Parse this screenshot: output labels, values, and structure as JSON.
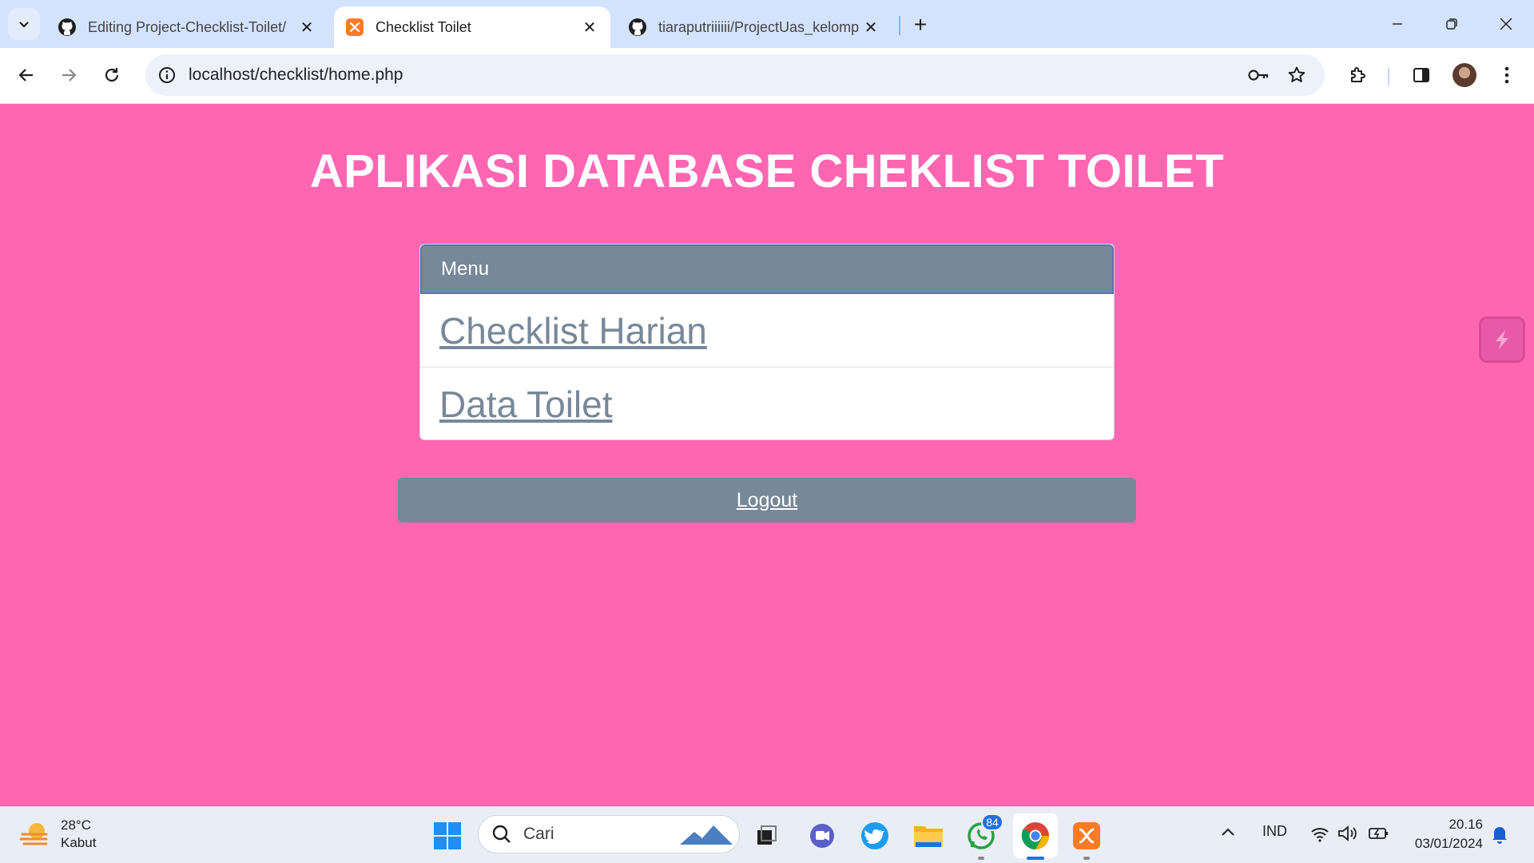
{
  "browser": {
    "tabs": [
      {
        "title": "Editing Project-Checklist-Toilet/",
        "favicon": "github-icon",
        "active": false
      },
      {
        "title": "Checklist Toilet",
        "favicon": "xampp-icon",
        "active": true
      },
      {
        "title": "tiaraputriiiiii/ProjectUas_kelomp",
        "favicon": "github-icon",
        "active": false
      }
    ],
    "url": "localhost/checklist/home.php"
  },
  "page": {
    "title": "APLIKASI DATABASE CHEKLIST TOILET",
    "menu": {
      "header": "Menu",
      "items": [
        {
          "label": "Checklist Harian"
        },
        {
          "label": "Data Toilet"
        }
      ]
    },
    "logout_label": "Logout"
  },
  "taskbar": {
    "weather": {
      "temp": "28°C",
      "condition": "Kabut"
    },
    "search_placeholder": "Cari",
    "whatsapp_badge": "84",
    "language": "IND",
    "time": "20.16",
    "date": "03/01/2024"
  },
  "colors": {
    "page_background": "#ff66b2",
    "panel_accent": "#778899",
    "tabbar": "#d3e3fd"
  }
}
